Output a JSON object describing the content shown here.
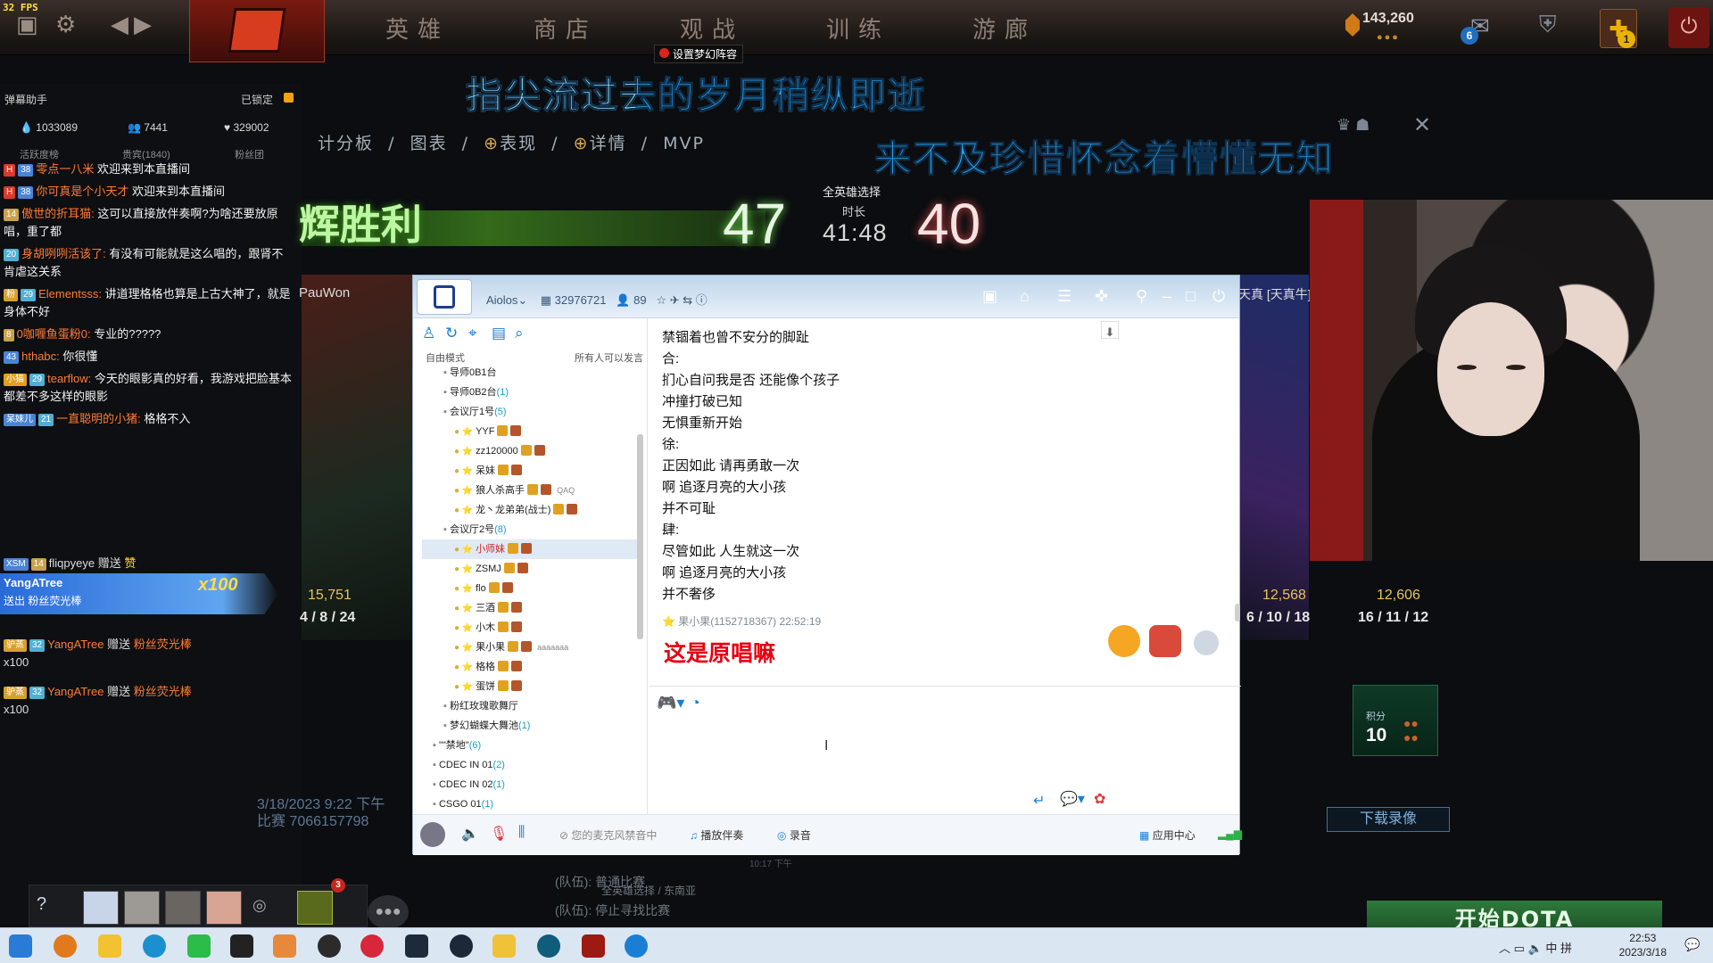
{
  "fps": "32 FPS",
  "topnav": {
    "items": [
      "英雄",
      "商店",
      "观战",
      "训练",
      "游廊"
    ],
    "coins": "143,260",
    "notif_count": "6",
    "plus_count": "1"
  },
  "tooltip": "设置梦幻阵容",
  "lyrics": {
    "line1": "指尖流过去的岁月稍纵即逝",
    "line2": "来不及珍惜怀念着懵懂无知"
  },
  "danmu": {
    "title": "弹幕助手",
    "locked": "已锁定",
    "stats": [
      "1033089",
      "7441",
      "329002"
    ],
    "tabs": [
      "活跃度榜",
      "贵宾(1840)",
      "粉丝团"
    ],
    "messages": [
      {
        "lv": "38",
        "name": "零点一八米",
        "text": "欢迎来到本直播间"
      },
      {
        "lv": "38",
        "name": "你可真是个小天才",
        "text": "欢迎来到本直播间"
      },
      {
        "lv": "14",
        "name": "傲世的折耳猫:",
        "text": "这可以直接放伴奏啊?为啥还要放原唱，重了都"
      },
      {
        "lv": "20",
        "name": "身胡咧咧活该了:",
        "text": "有没有可能就是这么唱的，跟肾不肯虐这关系"
      },
      {
        "lv": "29",
        "name": "Elementsss:",
        "text": "讲道理格格也算是上古大神了，就是身体不好"
      },
      {
        "lv": "8",
        "name": "0咖喱鱼蛋粉0:",
        "text": "专业的?????"
      },
      {
        "lv": "43",
        "name": "hthabc:",
        "text": "你很懂"
      },
      {
        "lv": "29",
        "name": "tearflow:",
        "text": "今天的眼影真的好看，我游戏把脸基本都差不多这样的眼影"
      },
      {
        "lv": "21",
        "name": "一直聪明的小猪:",
        "text": "格格不入"
      }
    ],
    "gifts": [
      {
        "user": "fliqpyeye",
        "action": "赠送",
        "item": "赞"
      },
      {
        "user": "YangATree",
        "action": "送出",
        "item": "粉丝荧光棒",
        "combo": "x100"
      },
      {
        "user": "YangATree",
        "action": "赠送",
        "item": "粉丝荧光棒",
        "count": "x100"
      },
      {
        "user": "YangATree",
        "action": "赠送",
        "item": "粉丝荧光棒",
        "count": "x100"
      }
    ]
  },
  "scoreboard": {
    "tabs": [
      "计分板",
      "图表",
      "表现",
      "详情",
      "MVP"
    ],
    "result": "辉胜利",
    "radiant": "47",
    "dire": "40",
    "mode": "全英雄选择",
    "duration_label": "时长",
    "duration": "41:48",
    "date": "3/18/2023 9:22 下午",
    "match": "比赛 7066157798",
    "players_left": [
      {
        "name": "PauWon",
        "gold": "15,751",
        "kda": "4 / 8 / 24"
      }
    ],
    "players_right": [
      {
        "name": "天真 [天真牛]",
        "gold": "12,568",
        "kda": "6 / 10 / 18"
      },
      {
        "gold": "12,606",
        "kda": "16 / 11 / 12"
      }
    ],
    "points_label": "积分",
    "points": "10",
    "download": "下载录像",
    "start": "开始DOTA"
  },
  "party": {
    "lines": [
      "(队伍): 普通比赛",
      "全英雄选择 / 东南亚",
      "(队伍): 停止寻找比赛",
      "10:17 下午"
    ],
    "badge": "3"
  },
  "qq": {
    "title": "Aiolos",
    "room_id": "32976721",
    "members": "89",
    "mode": "自由模式",
    "mode_right": "所有人可以发言",
    "tree": [
      {
        "t": "导师0B1台",
        "d": 2
      },
      {
        "t": "导师0B2台",
        "c": "(1)",
        "d": 2
      },
      {
        "t": "会议厅1号",
        "c": "(5)",
        "d": 2
      },
      {
        "t": "YYF",
        "d": 3
      },
      {
        "t": "zz120000",
        "d": 3
      },
      {
        "t": "呆妹",
        "d": 3
      },
      {
        "t": "狼人杀高手",
        "extra": "QAQ",
        "d": 3
      },
      {
        "t": "龙丶龙弟弟(战士)",
        "d": 3
      },
      {
        "t": "会议厅2号",
        "c": "(8)",
        "d": 2
      },
      {
        "t": "小师妹",
        "d": 3,
        "sel": true
      },
      {
        "t": "ZSMJ",
        "d": 3
      },
      {
        "t": "flo",
        "d": 3
      },
      {
        "t": "三酒",
        "d": 3
      },
      {
        "t": "小木",
        "d": 3
      },
      {
        "t": "果小果",
        "extra": "aaaaaaa",
        "d": 3
      },
      {
        "t": "格格",
        "d": 3
      },
      {
        "t": "蛋饼",
        "d": 3
      },
      {
        "t": "粉红玫瑰歌舞厅",
        "d": 2
      },
      {
        "t": "梦幻蝴蝶大舞池",
        "c": "(1)",
        "d": 2
      },
      {
        "t": "\"\"禁地\"",
        "c": "(6)",
        "d": 1
      },
      {
        "t": "CDEC IN 01",
        "c": "(2)",
        "d": 1
      },
      {
        "t": "CDEC IN 02",
        "c": "(1)",
        "d": 1
      },
      {
        "t": "CSGO 01",
        "c": "(1)",
        "d": 1
      }
    ],
    "chat_lines": [
      "禁锢着也曾不安分的脚趾",
      "合:",
      "扪心自问我是否 还能像个孩子",
      "冲撞打破已知",
      "无惧重新开始",
      "徐:",
      "正因如此 请再勇敢一次",
      "啊 追逐月亮的大小孩",
      "并不可耻",
      "肆:",
      "尽管如此 人生就这一次",
      "啊 追逐月亮的大小孩",
      "并不奢侈"
    ],
    "sender": "果小果(1152718367)  22:52:19",
    "big_msg": "这是原唱嘛",
    "footer": {
      "mic": "您的麦克风禁音中",
      "accompany": "播放伴奏",
      "record": "录音",
      "apps": "应用中心"
    }
  },
  "clock": {
    "time": "22:53",
    "date": "2023/3/18"
  },
  "tray": {
    "lang": "中",
    "ime": "拼"
  }
}
